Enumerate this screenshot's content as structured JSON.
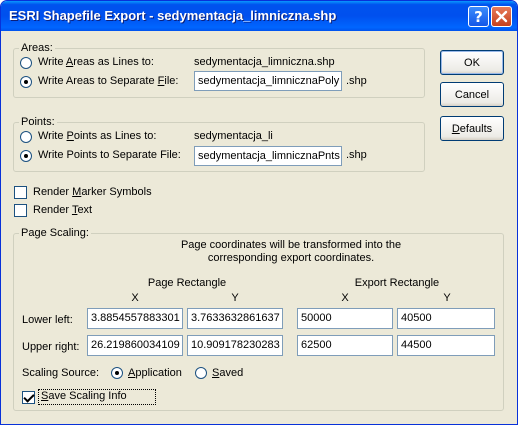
{
  "window": {
    "title": "ESRI Shapefile Export - sedymentacja_limniczna.shp"
  },
  "areas": {
    "group_label": "Areas:",
    "lines_option": {
      "pre": "Write ",
      "ul": "A",
      "post": "reas as Lines to:"
    },
    "lines_target": "sedymentacja_limniczna.shp",
    "separate_option": {
      "pre": "Write Areas to Separate ",
      "ul": "F",
      "post": "ile:"
    },
    "separate_value": "sedymentacja_limnicznaPoly",
    "extension": ".shp",
    "selected": "separate"
  },
  "points": {
    "group_label": "Points:",
    "lines_option": {
      "pre": "Write ",
      "ul": "P",
      "post": "oints as Lines to:"
    },
    "lines_target": "sedymentacja_li",
    "separate_option": {
      "pre": "Write Points to Separate File:",
      "ul": "",
      "post": ""
    },
    "separate_value": "sedymentacja_limnicznaPnts",
    "extension": ".shp",
    "selected": "separate"
  },
  "render": {
    "markers": {
      "pre": "Render ",
      "ul": "M",
      "post": "arker Symbols",
      "checked": false
    },
    "text": {
      "pre": "Render ",
      "ul": "T",
      "post": "ext",
      "checked": false
    }
  },
  "page_scaling": {
    "group_label": "Page Scaling:",
    "description_1": "Page coordinates will be transformed into the",
    "description_2": "corresponding export coordinates.",
    "page_rect_label": "Page Rectangle",
    "export_rect_label": "Export Rectangle",
    "x_label": "X",
    "y_label": "Y",
    "lower_left_label": "Lower left:",
    "upper_right_label": "Upper right:",
    "lower_left": {
      "page_x": "3.8854557883301",
      "page_y": "3.7633632861637",
      "export_x": "50000",
      "export_y": "40500"
    },
    "upper_right": {
      "page_x": "26.219860034109",
      "page_y": "10.909178230283",
      "export_x": "62500",
      "export_y": "44500"
    },
    "source_label": "Scaling Source:",
    "source_application": {
      "pre": "",
      "ul": "A",
      "post": "pplication"
    },
    "source_saved": {
      "pre": "",
      "ul": "S",
      "post": "aved"
    },
    "source_selected": "application",
    "save_info": {
      "pre": "",
      "ul": "S",
      "post": "ave Scaling Info",
      "checked": true
    }
  },
  "buttons": {
    "ok": "OK",
    "cancel": "Cancel",
    "defaults": {
      "pre": "",
      "ul": "D",
      "post": "efaults"
    }
  },
  "titlebar_buttons": {
    "help": "?"
  }
}
